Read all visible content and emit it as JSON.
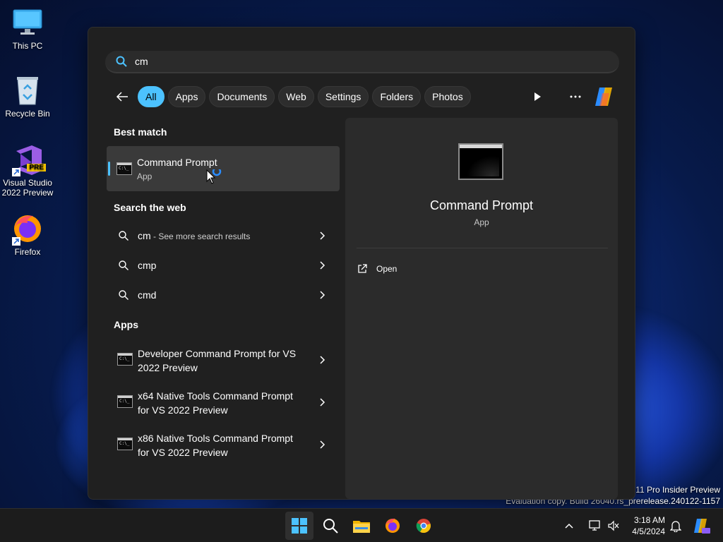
{
  "desktop": {
    "icons": [
      {
        "label": "This PC"
      },
      {
        "label": "Recycle Bin"
      },
      {
        "label": "Visual Studio 2022 Preview",
        "badge": "PRE"
      },
      {
        "label": "Firefox"
      }
    ],
    "watermark_line1": "s 11 Pro Insider Preview",
    "watermark_line2": "Evaluation copy. Build 26040.rs_prerelease.240122-1157"
  },
  "search": {
    "query": "cm",
    "filters": [
      "All",
      "Apps",
      "Documents",
      "Web",
      "Settings",
      "Folders",
      "Photos"
    ],
    "active_filter": "All"
  },
  "results": {
    "best_match_title": "Best match",
    "best_match": {
      "name": "Command Prompt",
      "type": "App"
    },
    "web_title": "Search the web",
    "web_items": [
      {
        "term": "cm",
        "suffix": " - See more search results"
      },
      {
        "term": "cmp",
        "suffix": ""
      },
      {
        "term": "cmd",
        "suffix": ""
      }
    ],
    "apps_title": "Apps",
    "apps": [
      {
        "name": "Developer Command Prompt for VS 2022 Preview"
      },
      {
        "name": "x64 Native Tools Command Prompt for VS 2022 Preview"
      },
      {
        "name": "x86 Native Tools Command Prompt for VS 2022 Preview"
      }
    ]
  },
  "preview": {
    "name": "Command Prompt",
    "type": "App",
    "actions": [
      {
        "label": "Open"
      }
    ]
  },
  "taskbar": {
    "time": "3:18 AM",
    "date": "4/5/2024",
    "apps": [
      "start-icon",
      "search-icon",
      "file-explorer-icon",
      "firefox-icon",
      "chrome-icon"
    ]
  },
  "colors": {
    "accent": "#4cc2ff",
    "panel": "#202020",
    "preview": "#2b2b2b"
  }
}
